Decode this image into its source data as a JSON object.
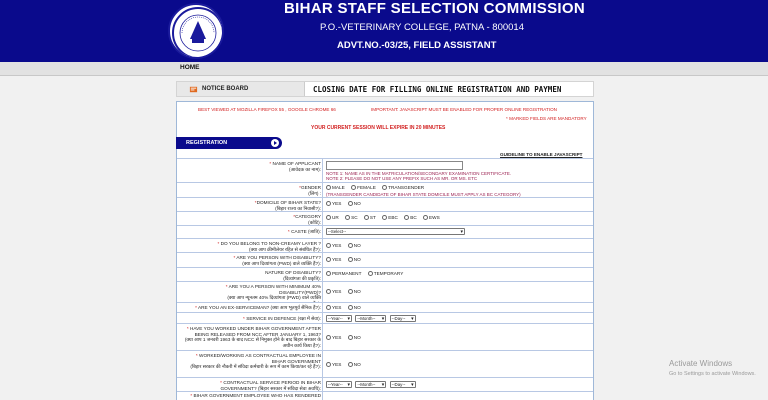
{
  "header": {
    "title": "BIHAR STAFF SELECTION COMMISSION",
    "address": "P.O.-VETERINARY COLLEGE, PATNA - 800014",
    "advt": "ADVT.NO.-03/25, FIELD ASSISTANT",
    "bg_color": "#0a0a8c",
    "logo_text": "Bihar Staff Selection Commission Patna"
  },
  "nav": {
    "home": "HOME"
  },
  "notice": {
    "label": "NOTICE BOARD",
    "marquee": "CLOSING DATE FOR FILLING ONLINE REGISTRATION AND PAYMEN"
  },
  "warnings": {
    "browser": "BEST VIEWED AT MOZILLA FIREFOX 55 , GOOGLE CHROME 66",
    "js": "IMPORTANT: JAVASCRIPT MUST BE ENABLED FOR PROPER ONLINE REGISTRATION",
    "mandatory": "* MARKED FIELDS ARE MANDATORY",
    "session": "YOUR CURRENT SESSION WILL EXPIRE IN 20 MINUTES"
  },
  "registration": {
    "tab": "REGISTRATION",
    "guide_link": "GUIDELINE TO ENABLE JAVASCRIPT"
  },
  "form": {
    "name_label": "NAME OF APPLICANT",
    "name_label_hi": "(आवेदक का नाम):",
    "name_value": "",
    "name_note1": "NOTE 1: NAME AS IN THE MATRICULATION/SECONDARY EXAMINATION CERTIFICATE.",
    "name_note2": "NOTE 2: PLEASE DO NOT USE ANY PREFIX SUCH AS MR. OR MS. ETC",
    "gender_label": "GENDER",
    "gender_label_hi": "(लिंग) :",
    "gender_opts": [
      "MALE",
      "FEMALE",
      "TRANSGENDER"
    ],
    "gender_note": "(TRANSGENDER CANDIDATE OF BIHAR STATE DOMICILE MUST APPLY AS BC CATEGORY)",
    "domicile_label": "DOMICILE OF BIHAR STATE?",
    "domicile_label_hi": "(बिहार राज्य का निवासी?):",
    "yes": "YES",
    "no": "NO",
    "category_label": "CATEGORY",
    "category_label_hi": "(कोटि):",
    "category_opts": [
      "UR",
      "SC",
      "ST",
      "EBC",
      "BC",
      "EWS"
    ],
    "caste_label": "CASTE (जाति):",
    "caste_select": "--Select--",
    "noncreamy_label": "DO YOU BELONG TO NON-CREAMY LAYER ?",
    "noncreamy_label_hi": "(क्या आप क्रीमीलेयर रहित से संबंधित हैं?):",
    "disability_label": "ARE YOU PERSON WITH DISABILITY?",
    "disability_label_hi": "(क्या आप दिव्यांगता (PWD) वाले व्यक्ति हैं?):",
    "nature_label": "NATURE OF DISABILITY?",
    "nature_label_hi": "(दिव्यांगता की प्रकृति):",
    "nature_opts": [
      "PERMANENT",
      "TEMPORARY"
    ],
    "min40_label": "ARE YOU A PERSON WITH MINIMUM 40% DISABILITY(PWD)?",
    "min40_label_hi": "(क्या आप न्यूनतम 40% दिव्यांगता (PWD) वाले व्यक्ति हैं?):",
    "exsm_label": "ARE YOU AN EX-SERVICEMAN? (क्या आप भूतपूर्व सैनिक हैं?):",
    "defence_label": "SERVICE IN DEFENCE (रक्षा में सेवा):",
    "year": "--Year--",
    "month": "--Month--",
    "day": "--Day--",
    "ncc_label": "HAVE YOU WORKED UNDER BIHAR GOVERNMENT AFTER BEING RELEASED FROM NCC AFTER JANUARY 1, 1963?",
    "ncc_label_hi": "(क्या आप 1 जनवरी 1963 के बाद NCC से निमुक्त होने के बाद बिहार सरकार के अधीन कार्य किया है?):",
    "contract_label": "WORKED/WORKING AS CONTRACTUAL EMPLOYEE IN BIHAR GOVERNMENT",
    "contract_label_hi": "(बिहार सरकार की नौकरी में संविदा कर्मचारी के रूप में काम किया/कर रहे हैं?):",
    "contract_period_label": "CONTRACTUAL SERVICE PERIOD IN BIHAR GOVERNMENT? (बिहार सरकार में संविदा सेवा अवधि):",
    "govt_emp_label": "BIHAR GOVERNMENT EMPLOYEE WHO HAS RENDERED"
  },
  "watermark": {
    "line1": "Activate Windows",
    "line2": "Go to Settings to activate Windows."
  }
}
